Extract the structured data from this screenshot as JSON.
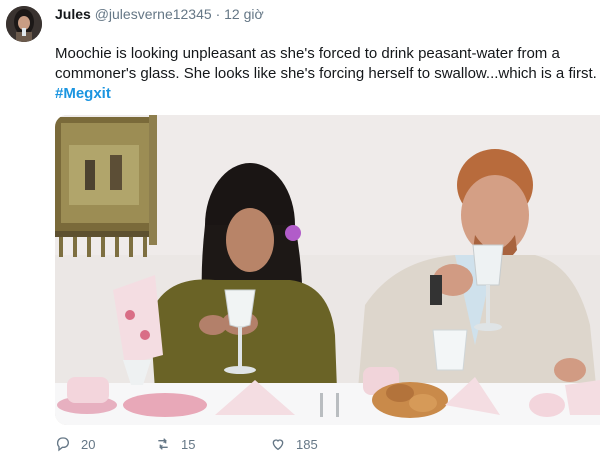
{
  "tweet": {
    "display_name": "Jules",
    "handle": "@julesverne12345",
    "separator": "·",
    "timestamp": "12 giờ",
    "text": "Moochie is looking unpleasant as she's forced to drink peasant-water from a commoner's glass.  She looks like she's forcing herself to swallow...which is a first.",
    "hashtag": "#Megxit"
  },
  "actions": {
    "reply_count": "20",
    "retweet_count": "15",
    "like_count": "185"
  },
  "icons": [
    "avatar",
    "reply-icon",
    "retweet-icon",
    "like-icon"
  ],
  "colors": {
    "link": "#1b95e0",
    "muted": "#657786",
    "text": "#14171a"
  }
}
